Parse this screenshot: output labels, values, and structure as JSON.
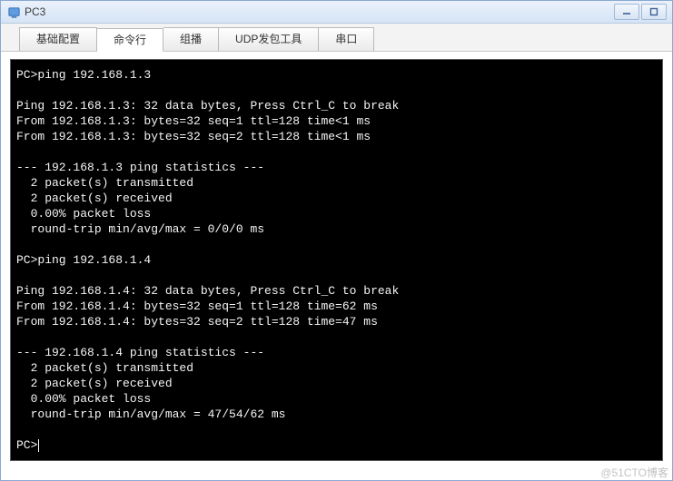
{
  "window": {
    "title": "PC3"
  },
  "tabs": [
    {
      "label": "基础配置",
      "active": false
    },
    {
      "label": "命令行",
      "active": true
    },
    {
      "label": "组播",
      "active": false
    },
    {
      "label": "UDP发包工具",
      "active": false
    },
    {
      "label": "串口",
      "active": false
    }
  ],
  "prompt": "PC>",
  "cmd1": "ping 192.168.1.3",
  "ping1": {
    "header": "Ping 192.168.1.3: 32 data bytes, Press Ctrl_C to break",
    "l1": "From 192.168.1.3: bytes=32 seq=1 ttl=128 time<1 ms",
    "l2": "From 192.168.1.3: bytes=32 seq=2 ttl=128 time<1 ms",
    "stat_head": "--- 192.168.1.3 ping statistics ---",
    "tx": "  2 packet(s) transmitted",
    "rx": "  2 packet(s) received",
    "loss": "  0.00% packet loss",
    "rtt": "  round-trip min/avg/max = 0/0/0 ms"
  },
  "cmd2": "ping 192.168.1.4",
  "ping2": {
    "header": "Ping 192.168.1.4: 32 data bytes, Press Ctrl_C to break",
    "l1": "From 192.168.1.4: bytes=32 seq=1 ttl=128 time=62 ms",
    "l2": "From 192.168.1.4: bytes=32 seq=2 ttl=128 time=47 ms",
    "stat_head": "--- 192.168.1.4 ping statistics ---",
    "tx": "  2 packet(s) transmitted",
    "rx": "  2 packet(s) received",
    "loss": "  0.00% packet loss",
    "rtt": "  round-trip min/avg/max = 47/54/62 ms"
  },
  "watermark": "@51CTO博客"
}
